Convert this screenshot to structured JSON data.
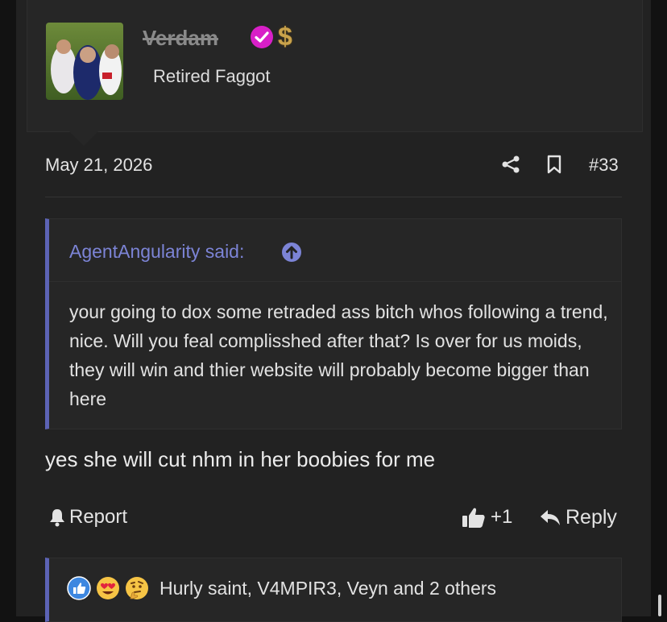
{
  "user": {
    "username": "Verdam",
    "title": "Retired Faggot",
    "badge_symbol": "$",
    "verified_color": "#d81fc7",
    "badge_color": "#c9a24b"
  },
  "post": {
    "date": "May 21, 2026",
    "number": "#33",
    "message": "yes she will cut nhm in her boobies for me"
  },
  "quote": {
    "attribution": "AgentAngularity said:",
    "body": "your going to dox some retraded ass bitch whos following a trend, nice. Will you feal complisshed after that? Is over for us moids, they will win and thier website will probably become bigger than here",
    "accent_color": "#5c63b5"
  },
  "actions": {
    "report_label": "Report",
    "like_count": "+1",
    "reply_label": "Reply"
  },
  "reactions": {
    "icons": [
      "like-icon",
      "heart-eyes-icon",
      "thinking-face-icon"
    ],
    "text": "Hurly saint, V4MPIR3, Veyn and 2 others"
  }
}
